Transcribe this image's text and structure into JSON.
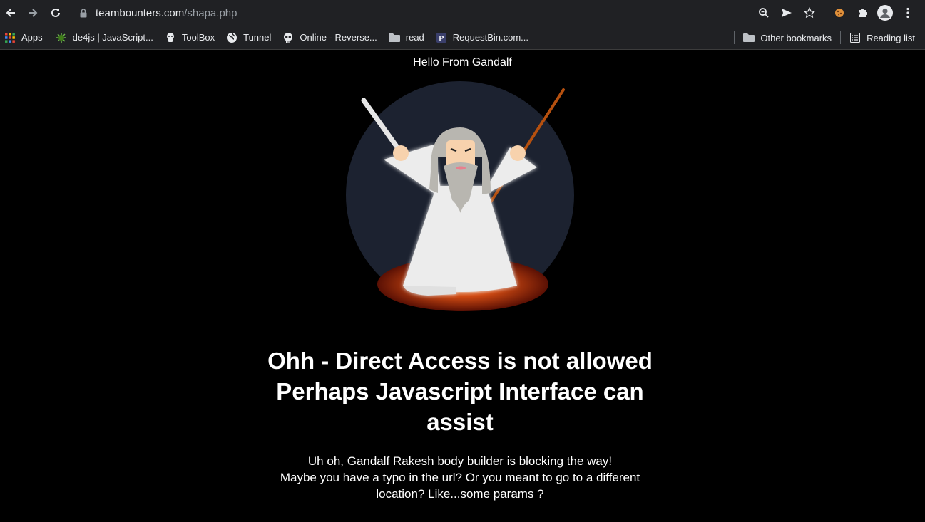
{
  "browser": {
    "url_host": "teambounters.com",
    "url_path": "/shapa.php",
    "bookmarks": [
      {
        "label": "Apps",
        "icon": "apps-grid-icon"
      },
      {
        "label": "de4js | JavaScript...",
        "icon": "de4js-icon"
      },
      {
        "label": "ToolBox",
        "icon": "toolbox-icon"
      },
      {
        "label": "Tunnel",
        "icon": "globe-icon"
      },
      {
        "label": "Online - Reverse...",
        "icon": "skull-icon"
      },
      {
        "label": "read",
        "icon": "folder-icon"
      },
      {
        "label": "RequestBin.com...",
        "icon": "requestbin-icon"
      }
    ],
    "other_bookmarks": "Other bookmarks",
    "reading_list": "Reading list"
  },
  "page": {
    "hello": "Hello From Gandalf",
    "headline_line1": "Ohh - Direct Access is not allowed",
    "headline_line2": "Perhaps Javascript Interface can",
    "headline_line3": "assist",
    "desc_line1": "Uh oh, Gandalf Rakesh body builder is blocking the way!",
    "desc_line2": "Maybe you have a typo in the url? Or you meant to go to a different",
    "desc_line3": "location? Like...some params ?"
  },
  "colors": {
    "chrome_bg": "#202124",
    "page_bg": "#000000",
    "circle_bg": "#1c2230",
    "staff": "#b5500f",
    "fire": "#c0340a"
  }
}
